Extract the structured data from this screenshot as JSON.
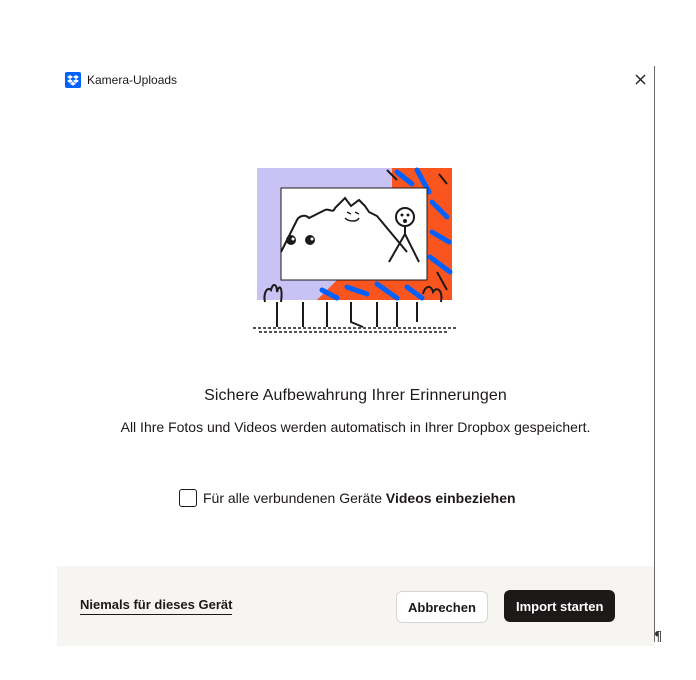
{
  "window": {
    "title": "Kamera-Uploads",
    "app_icon": "dropbox-icon",
    "close_icon": "close-icon"
  },
  "main": {
    "headline": "Sichere Aufbewahrung Ihrer Erinnerungen",
    "subtext": "All Ihre Fotos und Videos werden automatisch in Ihrer Dropbox gespeichert.",
    "illustration": "photo-frame-illustration"
  },
  "option": {
    "label_prefix": "Für alle verbundenen Geräte ",
    "label_bold": "Videos einbeziehen",
    "checked": false
  },
  "footer": {
    "never_label": "Niemals für dieses Gerät",
    "cancel_label": "Abbrechen",
    "start_label": "Import starten"
  },
  "colors": {
    "brand_blue": "#0061fe",
    "orange": "#fa551e",
    "lavender": "#c8c2f5",
    "dark": "#1e1919",
    "footer_bg": "#f7f5f2"
  },
  "stray_mark": "¶"
}
